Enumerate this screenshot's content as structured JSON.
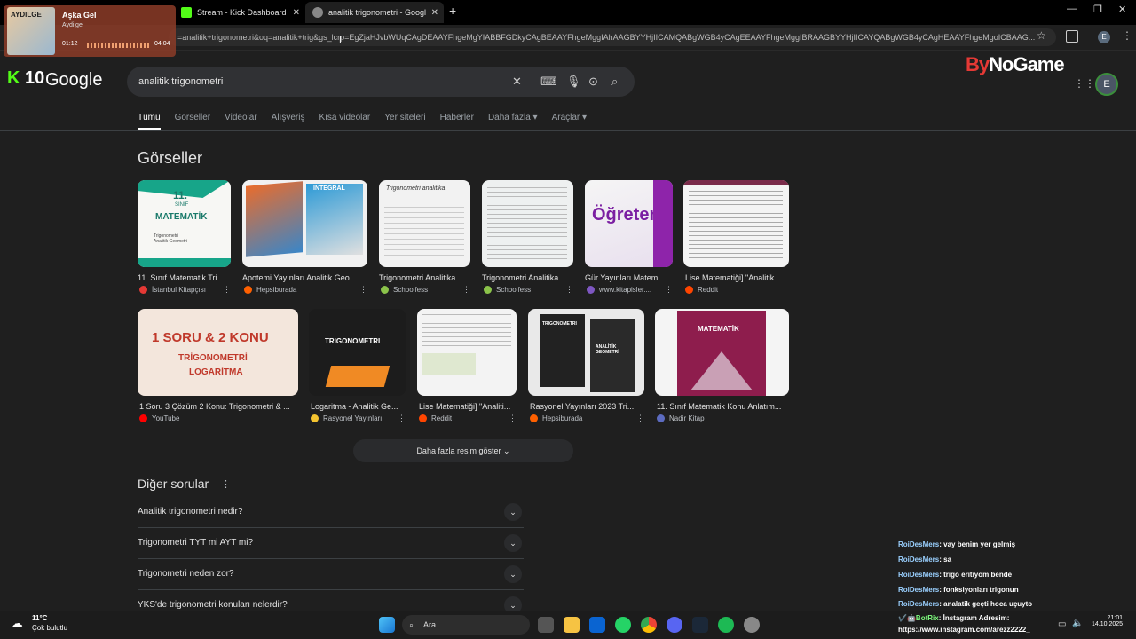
{
  "tabs": [
    {
      "label": "Stream - Kick Dashboard"
    },
    {
      "label": "analitik trigonometri - Google Ar"
    }
  ],
  "address_bar": {
    "url": "=analitik+trigonometri&oq=analitik+trig&gs_lcrp=EgZjaHJvbWUqCAgDEAAYFhgeMgYIABBFGDkyCAgBEAAYFhgeMggIAhAAGBYYHjIICAMQABgWGB4yCAgEEAAYFhgeMggIBRAAGBYYHjIICAYQABgWGB4yCAgHEAAYFhgeMgoICBAAG..."
  },
  "music": {
    "song": "Aşka Gel",
    "artist": "Aydilge",
    "time_elapsed": "01:12",
    "time_total": "04:04",
    "cover_text": "AYDILGE"
  },
  "kick_badge": {
    "k": "K",
    "num": "10"
  },
  "google_logo": "Google",
  "search": {
    "query": "analitik trigonometri"
  },
  "bynogame": {
    "by": "By",
    "rest": "NoGame"
  },
  "account_initial": "E",
  "nav_tabs": [
    "Tümü",
    "Görseller",
    "Videolar",
    "Alışveriş",
    "Kısa videolar",
    "Yer siteleri",
    "Haberler",
    "Daha fazla ▾",
    "Araçlar ▾"
  ],
  "images_heading": "Görseller",
  "image_results": [
    {
      "title": "11. Sınıf Matematik Tri...",
      "source": "İstanbul Kitapçısı",
      "color": "#e53935"
    },
    {
      "title": "Apotemi Yayınları Analitik Geo...",
      "source": "Hepsiburada",
      "color": "#ff6000"
    },
    {
      "title": "Trigonometri Analitika...",
      "source": "Schoolfess",
      "color": "#8bc34a"
    },
    {
      "title": "Trigonometri Analitika...",
      "source": "Schoolfess",
      "color": "#8bc34a"
    },
    {
      "title": "Gür Yayınları Matem...",
      "source": "www.kitapisler....",
      "color": "#7e57c2"
    },
    {
      "title": "Lise Matematiği] \"Analitik ...",
      "source": "Reddit",
      "color": "#ff4500"
    },
    {
      "title": "1 Soru 3 Çözüm 2 Konu: Trigonometri & ...",
      "source": "YouTube",
      "color": "#ff0000"
    },
    {
      "title": "Logaritma - Analitik Ge...",
      "source": "Rasyonel Yayınları",
      "color": "#f4c430"
    },
    {
      "title": "Lise Matematiği] \"Analiti...",
      "source": "Reddit",
      "color": "#ff4500"
    },
    {
      "title": "Rasyonel Yayınları 2023 Tri...",
      "source": "Hepsiburada",
      "color": "#ff6000"
    },
    {
      "title": "11. Sınıf Matematik Konu Anlatım...",
      "source": "Nadir Kitap",
      "color": "#5c6bc0"
    }
  ],
  "image_texts": {
    "c1_grade": "11.",
    "c1_grade2": "SINIF",
    "c1_title": "MATEMATİK",
    "c1_sub": "Trigonometri\nAnalitik Geometri",
    "c2_label": "INTEGRAL",
    "c3_label": "Trigonometri analitika",
    "c5_title": "Öğreten",
    "c7_l1": "1 SORU & 2 KONU",
    "c7_l2": "TRİGONOMETRİ",
    "c7_l3": "LOGARİTMA",
    "c8_title": "TRIGONOMETRI",
    "c10_a": "TRIGONOMETRI",
    "c10_b": "ANALİTİK GEOMETRİ",
    "c11_title": "MATEMATİK"
  },
  "more_images": "Daha fazla resim göster",
  "questions_heading": "Diğer sorular",
  "questions": [
    "Analitik trigonometri nedir?",
    "Trigonometri TYT mi AYT mi?",
    "Trigonometri neden zor?",
    "YKS'de trigonometri konuları nelerdir?"
  ],
  "chat": [
    {
      "user": "RoiDesMers",
      "msg": ": vay benim yer gelmiş"
    },
    {
      "user": "RoiDesMers",
      "msg": ": sa"
    },
    {
      "user": "RoiDesMers",
      "msg": ": trigo eritiyom bende"
    },
    {
      "user": "RoiDesMers",
      "msg": ": fonksiyonları trigonun"
    },
    {
      "user": "RoiDesMers",
      "msg": ": analatik geçti hoca uçuyto"
    },
    {
      "user": "✔️🤖BotRix",
      "msg": ": İnstagram Adresim:"
    },
    {
      "user": "",
      "msg": "https://www.instagram.com/arezz2222_"
    }
  ],
  "weather": {
    "temp": "11°C",
    "desc": "Çok bulutlu"
  },
  "taskbar_search": "Ara",
  "clock": {
    "time": "21:01",
    "date": "14.10.2025"
  }
}
